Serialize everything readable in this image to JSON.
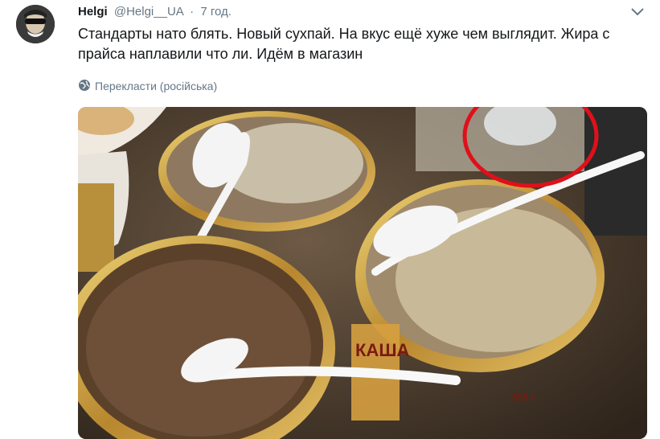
{
  "tweet": {
    "name": "Helgi",
    "handle": "@Helgi__UA",
    "separator": "·",
    "time": "7 год.",
    "text": "Стандарты нато блять. Новый сухпай. На вкус ещё хуже чем выглядит. Жира с прайса наплавили что ли. Идём в магазин",
    "translate_label": "Перекласти (російська)"
  },
  "photo": {
    "can_label": "КАША",
    "can_weight": "525 г"
  },
  "icons": {
    "globe": "globe-icon",
    "chevron": "chevron-down-icon",
    "avatar": "avatar"
  },
  "colors": {
    "name": "#14171a",
    "meta": "#657786",
    "annotation_circle": "#e0101a"
  }
}
